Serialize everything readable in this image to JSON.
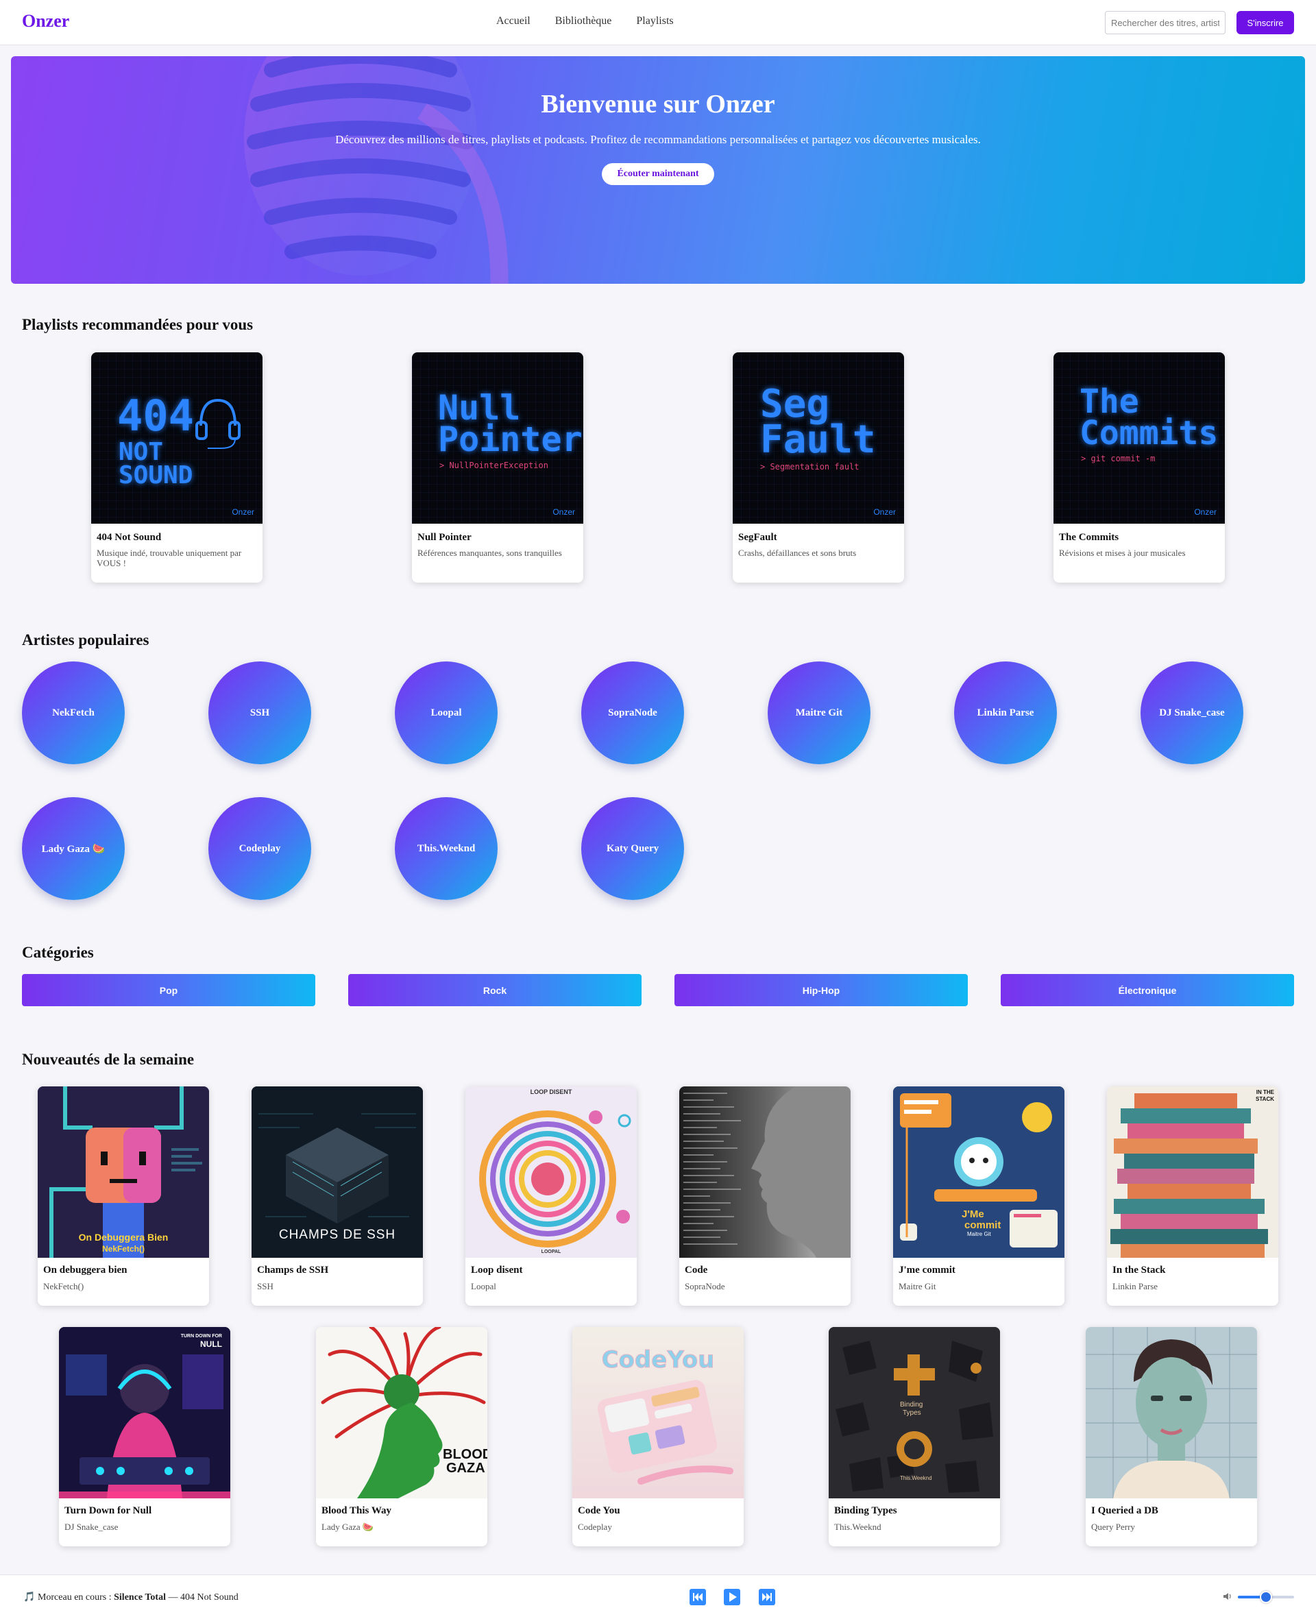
{
  "header": {
    "logo": "Onzer",
    "nav": [
      "Accueil",
      "Bibliothèque",
      "Playlists"
    ],
    "search_placeholder": "Rechercher des titres, artistes",
    "signup_label": "S'inscrire"
  },
  "hero": {
    "title": "Bienvenue sur Onzer",
    "subtitle": "Découvrez des millions de titres, playlists et podcasts. Profitez de recommandations personnalisées et partagez vos découvertes musicales.",
    "cta_label": "Écouter maintenant"
  },
  "playlists": {
    "heading": "Playlists recommandées pour vous",
    "items": [
      {
        "title": "404 Not Sound",
        "description": "Musique indé, trouvable uniquement par VOUS !",
        "cover_lines": [
          "404",
          "NOT",
          "SOUND"
        ],
        "cover_term": "",
        "brand": "Onzer"
      },
      {
        "title": "Null Pointer",
        "description": "Références manquantes, sons tranquilles",
        "cover_lines": [
          "Null",
          "Pointer"
        ],
        "cover_term": "> NullPointerException",
        "brand": "Onzer"
      },
      {
        "title": "SegFault",
        "description": "Crashs, défaillances et sons bruts",
        "cover_lines": [
          "Seg",
          "Fault"
        ],
        "cover_term": "> Segmentation fault",
        "brand": "Onzer"
      },
      {
        "title": "The Commits",
        "description": "Révisions et mises à jour musicales",
        "cover_lines": [
          "The",
          "Commits"
        ],
        "cover_term": "> git commit -m",
        "brand": "Onzer"
      }
    ]
  },
  "artists": {
    "heading": "Artistes populaires",
    "items": [
      "NekFetch",
      "SSH",
      "Loopal",
      "SopraNode",
      "Maitre Git",
      "Linkin Parse",
      "DJ Snake_case",
      "Lady Gaza 🍉",
      "Codeplay",
      "This.Weeknd",
      "Katy Query"
    ]
  },
  "categories": {
    "heading": "Catégories",
    "items": [
      "Pop",
      "Rock",
      "Hip-Hop",
      "Électronique"
    ]
  },
  "releases": {
    "heading": "Nouveautés de la semaine",
    "items": [
      {
        "title": "On debuggera bien",
        "artist": "NekFetch()",
        "cover_text": [
          "On Debuggera Bien",
          "NekFetch()"
        ],
        "icon": "robot-cover-art"
      },
      {
        "title": "Champs de SSH",
        "artist": "SSH",
        "cover_text": [
          "CHAMPS DE SSH"
        ],
        "icon": "server-cube-cover-art"
      },
      {
        "title": "Loop disent",
        "artist": "Loopal",
        "cover_text": [
          "LOOP DISENT",
          "LOOPAL"
        ],
        "icon": "concentric-loop-cover-art"
      },
      {
        "title": "Code",
        "artist": "SopraNode",
        "cover_text": [],
        "icon": "profile-face-cover-art"
      },
      {
        "title": "J'me commit",
        "artist": "Maitre Git",
        "cover_text": [
          "J'Me",
          "commit",
          "Maitre Git"
        ],
        "icon": "git-octocat-cover-art"
      },
      {
        "title": "In the Stack",
        "artist": "Linkin Parse",
        "cover_text": [
          "IN THE",
          "STACK"
        ],
        "icon": "stacked-blocks-cover-art"
      },
      {
        "title": "Turn Down for Null",
        "artist": "DJ Snake_case",
        "cover_text": [
          "TURN DOWN FOR",
          "NULL"
        ],
        "icon": "dj-neon-cover-art"
      },
      {
        "title": "Blood This Way",
        "artist": "Lady Gaza 🍉",
        "cover_text": [
          "BLOOD",
          "GAZA"
        ],
        "icon": "green-face-cover-art"
      },
      {
        "title": "Code You",
        "artist": "Codeplay",
        "cover_text": [
          "CodeYou"
        ],
        "icon": "pastel-ui-cover-art"
      },
      {
        "title": "Binding Types",
        "artist": "This.Weeknd",
        "cover_text": [
          "Binding",
          "Types",
          "This.Weeknd"
        ],
        "icon": "dark-shapes-cover-art"
      },
      {
        "title": "I Queried a DB",
        "artist": "Query Perry",
        "cover_text": [],
        "icon": "portrait-cover-art"
      }
    ]
  },
  "player": {
    "now_playing_prefix": "Morceau en cours :",
    "track": "Silence Total",
    "separator": "—",
    "artist": "404 Not Sound",
    "volume": 0.5,
    "accent": "#2f8bff"
  },
  "colors": {
    "brand": "#6d18e8",
    "gradient_start": "#7a2ef0",
    "gradient_end": "#12b2ec"
  }
}
